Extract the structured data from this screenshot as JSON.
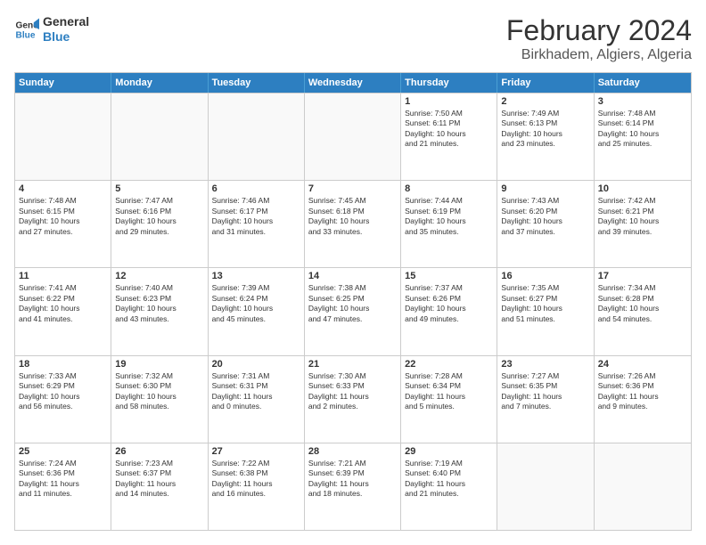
{
  "logo": {
    "line1": "General",
    "line2": "Blue"
  },
  "title": "February 2024",
  "subtitle": "Birkhadem, Algiers, Algeria",
  "days": [
    "Sunday",
    "Monday",
    "Tuesday",
    "Wednesday",
    "Thursday",
    "Friday",
    "Saturday"
  ],
  "rows": [
    [
      {
        "num": "",
        "text": "",
        "empty": true
      },
      {
        "num": "",
        "text": "",
        "empty": true
      },
      {
        "num": "",
        "text": "",
        "empty": true
      },
      {
        "num": "",
        "text": "",
        "empty": true
      },
      {
        "num": "1",
        "text": "Sunrise: 7:50 AM\nSunset: 6:11 PM\nDaylight: 10 hours\nand 21 minutes."
      },
      {
        "num": "2",
        "text": "Sunrise: 7:49 AM\nSunset: 6:13 PM\nDaylight: 10 hours\nand 23 minutes."
      },
      {
        "num": "3",
        "text": "Sunrise: 7:48 AM\nSunset: 6:14 PM\nDaylight: 10 hours\nand 25 minutes."
      }
    ],
    [
      {
        "num": "4",
        "text": "Sunrise: 7:48 AM\nSunset: 6:15 PM\nDaylight: 10 hours\nand 27 minutes."
      },
      {
        "num": "5",
        "text": "Sunrise: 7:47 AM\nSunset: 6:16 PM\nDaylight: 10 hours\nand 29 minutes."
      },
      {
        "num": "6",
        "text": "Sunrise: 7:46 AM\nSunset: 6:17 PM\nDaylight: 10 hours\nand 31 minutes."
      },
      {
        "num": "7",
        "text": "Sunrise: 7:45 AM\nSunset: 6:18 PM\nDaylight: 10 hours\nand 33 minutes."
      },
      {
        "num": "8",
        "text": "Sunrise: 7:44 AM\nSunset: 6:19 PM\nDaylight: 10 hours\nand 35 minutes."
      },
      {
        "num": "9",
        "text": "Sunrise: 7:43 AM\nSunset: 6:20 PM\nDaylight: 10 hours\nand 37 minutes."
      },
      {
        "num": "10",
        "text": "Sunrise: 7:42 AM\nSunset: 6:21 PM\nDaylight: 10 hours\nand 39 minutes."
      }
    ],
    [
      {
        "num": "11",
        "text": "Sunrise: 7:41 AM\nSunset: 6:22 PM\nDaylight: 10 hours\nand 41 minutes."
      },
      {
        "num": "12",
        "text": "Sunrise: 7:40 AM\nSunset: 6:23 PM\nDaylight: 10 hours\nand 43 minutes."
      },
      {
        "num": "13",
        "text": "Sunrise: 7:39 AM\nSunset: 6:24 PM\nDaylight: 10 hours\nand 45 minutes."
      },
      {
        "num": "14",
        "text": "Sunrise: 7:38 AM\nSunset: 6:25 PM\nDaylight: 10 hours\nand 47 minutes."
      },
      {
        "num": "15",
        "text": "Sunrise: 7:37 AM\nSunset: 6:26 PM\nDaylight: 10 hours\nand 49 minutes."
      },
      {
        "num": "16",
        "text": "Sunrise: 7:35 AM\nSunset: 6:27 PM\nDaylight: 10 hours\nand 51 minutes."
      },
      {
        "num": "17",
        "text": "Sunrise: 7:34 AM\nSunset: 6:28 PM\nDaylight: 10 hours\nand 54 minutes."
      }
    ],
    [
      {
        "num": "18",
        "text": "Sunrise: 7:33 AM\nSunset: 6:29 PM\nDaylight: 10 hours\nand 56 minutes."
      },
      {
        "num": "19",
        "text": "Sunrise: 7:32 AM\nSunset: 6:30 PM\nDaylight: 10 hours\nand 58 minutes."
      },
      {
        "num": "20",
        "text": "Sunrise: 7:31 AM\nSunset: 6:31 PM\nDaylight: 11 hours\nand 0 minutes."
      },
      {
        "num": "21",
        "text": "Sunrise: 7:30 AM\nSunset: 6:33 PM\nDaylight: 11 hours\nand 2 minutes."
      },
      {
        "num": "22",
        "text": "Sunrise: 7:28 AM\nSunset: 6:34 PM\nDaylight: 11 hours\nand 5 minutes."
      },
      {
        "num": "23",
        "text": "Sunrise: 7:27 AM\nSunset: 6:35 PM\nDaylight: 11 hours\nand 7 minutes."
      },
      {
        "num": "24",
        "text": "Sunrise: 7:26 AM\nSunset: 6:36 PM\nDaylight: 11 hours\nand 9 minutes."
      }
    ],
    [
      {
        "num": "25",
        "text": "Sunrise: 7:24 AM\nSunset: 6:36 PM\nDaylight: 11 hours\nand 11 minutes."
      },
      {
        "num": "26",
        "text": "Sunrise: 7:23 AM\nSunset: 6:37 PM\nDaylight: 11 hours\nand 14 minutes."
      },
      {
        "num": "27",
        "text": "Sunrise: 7:22 AM\nSunset: 6:38 PM\nDaylight: 11 hours\nand 16 minutes."
      },
      {
        "num": "28",
        "text": "Sunrise: 7:21 AM\nSunset: 6:39 PM\nDaylight: 11 hours\nand 18 minutes."
      },
      {
        "num": "29",
        "text": "Sunrise: 7:19 AM\nSunset: 6:40 PM\nDaylight: 11 hours\nand 21 minutes."
      },
      {
        "num": "",
        "text": "",
        "empty": true
      },
      {
        "num": "",
        "text": "",
        "empty": true
      }
    ]
  ]
}
